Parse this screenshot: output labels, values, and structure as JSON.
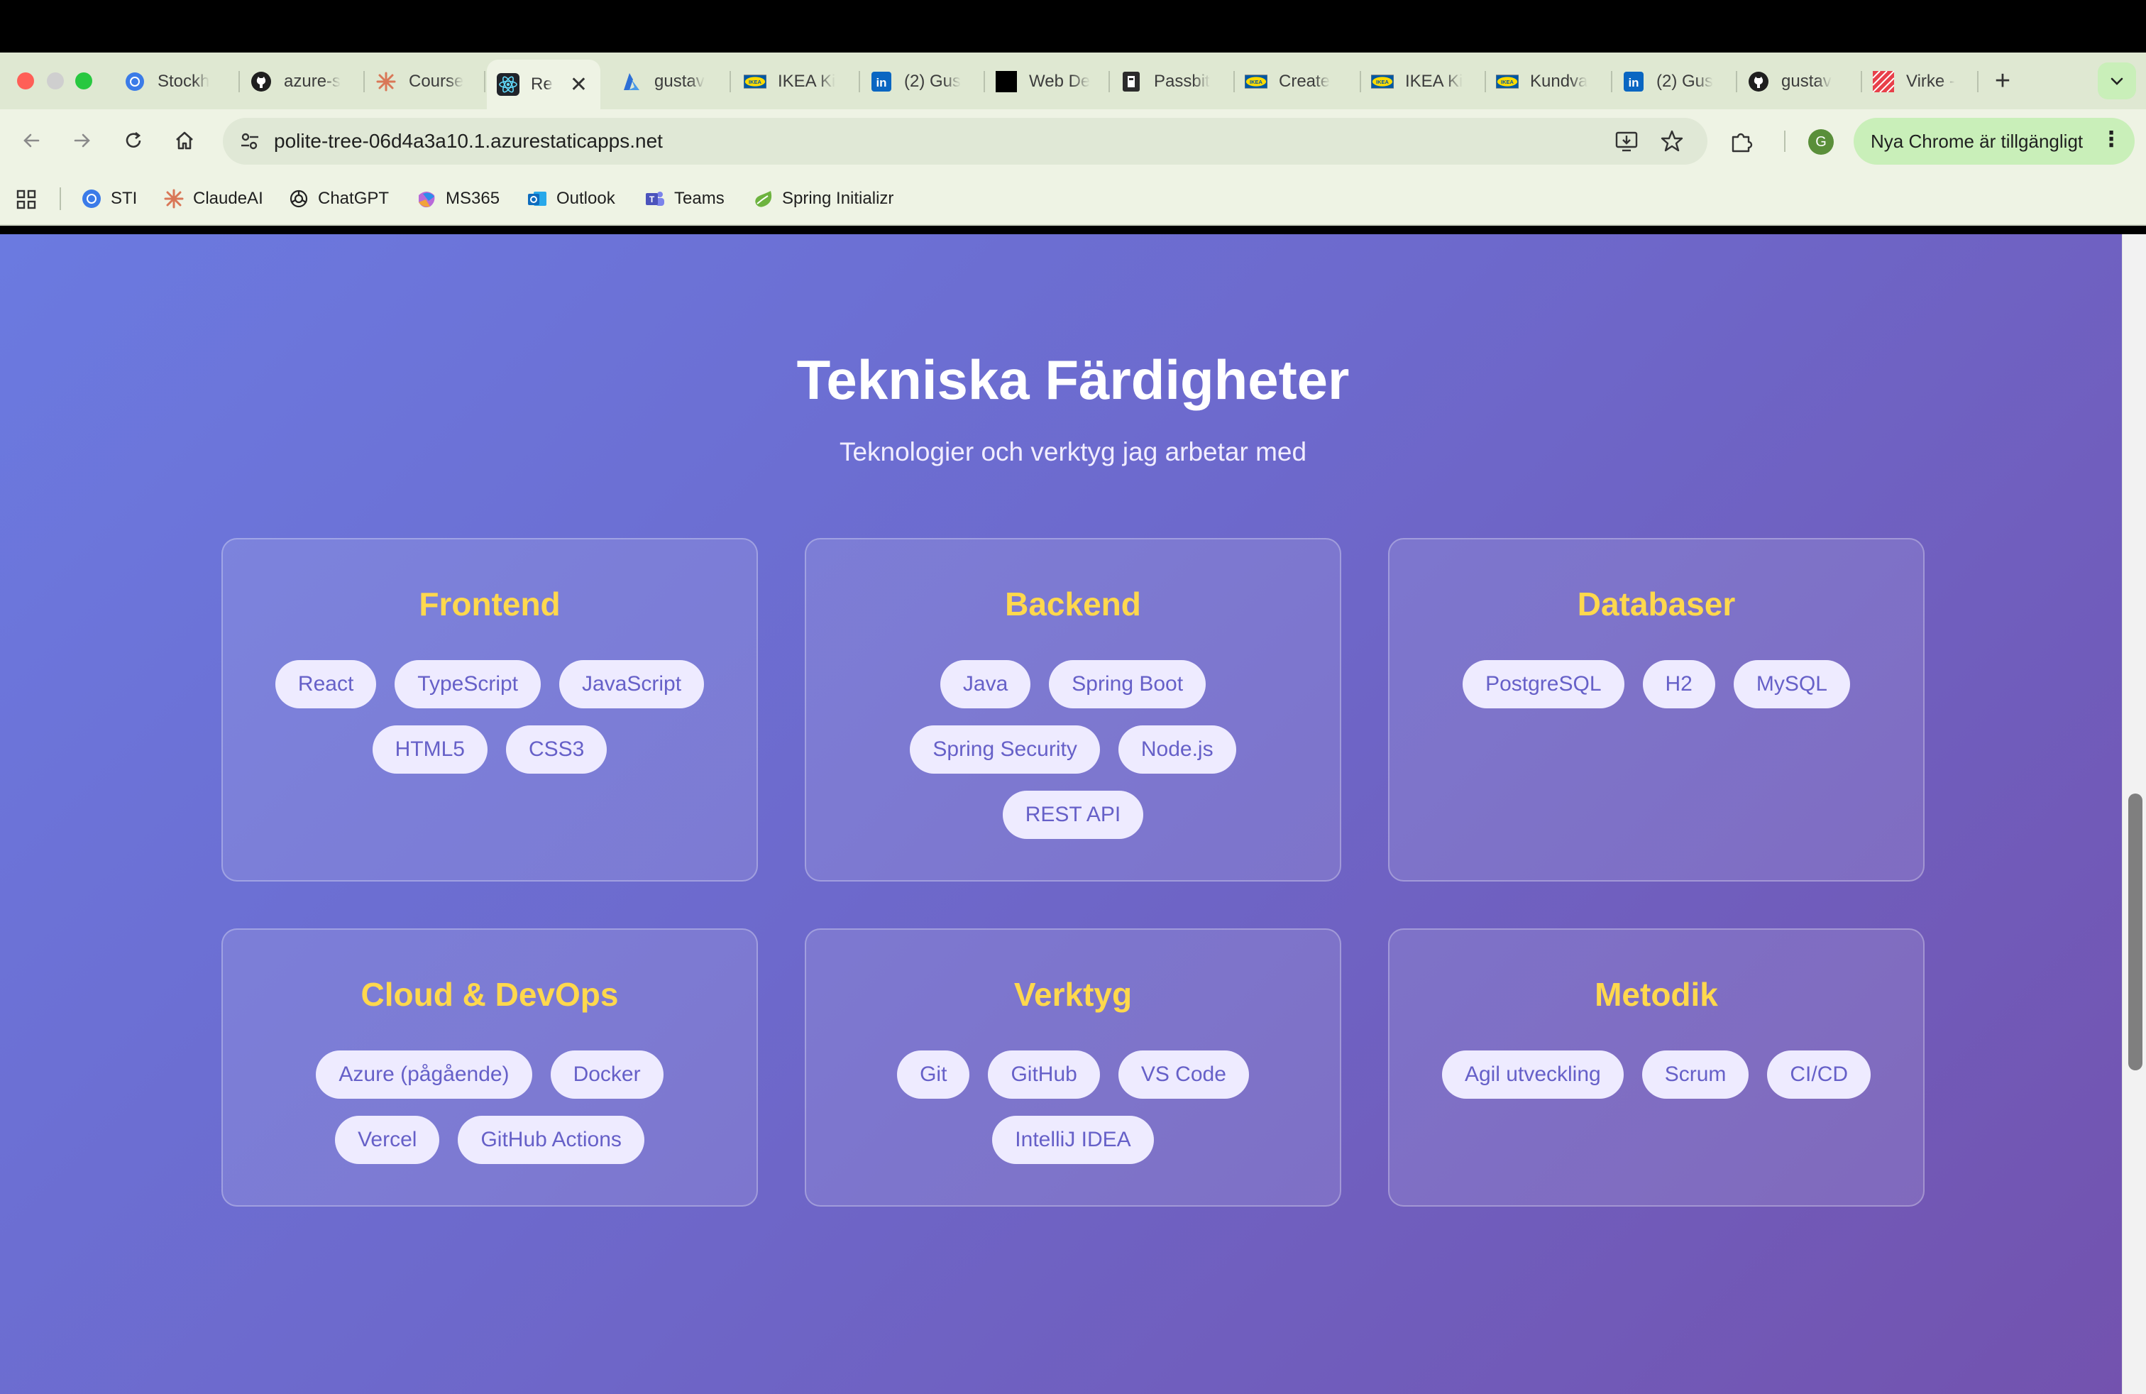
{
  "browser": {
    "tabs": [
      {
        "label": "Stockh",
        "icon": "chromium-icon"
      },
      {
        "label": "azure-s",
        "icon": "github-icon"
      },
      {
        "label": "Course",
        "icon": "claude-icon"
      },
      {
        "label": "Re",
        "icon": "react-icon",
        "active": true
      },
      {
        "label": "gustav",
        "icon": "azure-icon"
      },
      {
        "label": "IKEA Ki",
        "icon": "ikea-icon"
      },
      {
        "label": "(2) Gus",
        "icon": "linkedin-icon"
      },
      {
        "label": "Web De",
        "icon": "black-square-icon"
      },
      {
        "label": "Passbit",
        "icon": "passbit-icon"
      },
      {
        "label": "Create",
        "icon": "ikea-icon"
      },
      {
        "label": "IKEA Ki",
        "icon": "ikea-icon"
      },
      {
        "label": "Kundva",
        "icon": "ikea-icon"
      },
      {
        "label": "(2) Gus",
        "icon": "linkedin-icon"
      },
      {
        "label": "gustav",
        "icon": "github-icon"
      },
      {
        "label": "Virke -",
        "icon": "virke-icon"
      }
    ],
    "new_tab": "+",
    "url": "polite-tree-06d4a3a10.1.azurestaticapps.net",
    "profile_initial": "G",
    "update_label": "Nya Chrome är tillgängligt",
    "bookmarks": [
      {
        "label": "STI",
        "icon": "chromium-icon"
      },
      {
        "label": "ClaudeAI",
        "icon": "claude-icon"
      },
      {
        "label": "ChatGPT",
        "icon": "openai-icon"
      },
      {
        "label": "MS365",
        "icon": "ms365-icon"
      },
      {
        "label": "Outlook",
        "icon": "outlook-icon"
      },
      {
        "label": "Teams",
        "icon": "teams-icon"
      },
      {
        "label": "Spring Initializr",
        "icon": "spring-icon"
      }
    ],
    "colors": {
      "chrome_bg": "#eef3e4",
      "tabstrip_bg": "#dfe8d2",
      "update_chip": "#c9efb9"
    }
  },
  "page": {
    "title": "Tekniska Färdigheter",
    "subtitle": "Teknologier och verktyg jag arbetar med",
    "colors": {
      "heading_accent": "#ffd84d",
      "gradient_start": "#6b7ae0",
      "gradient_end": "#7352ae",
      "tag_text": "#6660c8",
      "tag_bg": "#eeebff"
    },
    "categories": [
      {
        "title": "Frontend",
        "skills": [
          "React",
          "TypeScript",
          "JavaScript",
          "HTML5",
          "CSS3"
        ]
      },
      {
        "title": "Backend",
        "skills": [
          "Java",
          "Spring Boot",
          "Spring Security",
          "Node.js",
          "REST API"
        ]
      },
      {
        "title": "Databaser",
        "skills": [
          "PostgreSQL",
          "H2",
          "MySQL"
        ]
      },
      {
        "title": "Cloud & DevOps",
        "skills": [
          "Azure (pågående)",
          "Docker",
          "Vercel",
          "GitHub Actions"
        ]
      },
      {
        "title": "Verktyg",
        "skills": [
          "Git",
          "GitHub",
          "VS Code",
          "IntelliJ IDEA"
        ]
      },
      {
        "title": "Metodik",
        "skills": [
          "Agil utveckling",
          "Scrum",
          "CI/CD"
        ]
      }
    ]
  }
}
